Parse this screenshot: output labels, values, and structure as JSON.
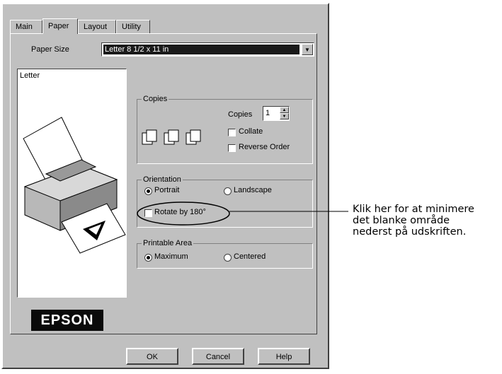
{
  "tabs": [
    "Main",
    "Paper",
    "Layout",
    "Utility"
  ],
  "paper_size": {
    "label": "Paper Size",
    "value": "Letter 8 1/2 x 11 in"
  },
  "preview": {
    "label": "Letter",
    "logo": "EPSON"
  },
  "copies_group": {
    "title": "Copies",
    "copies_label": "Copies",
    "copies_value": "1",
    "collate_label": "Collate",
    "reverse_label": "Reverse Order"
  },
  "orientation_group": {
    "title": "Orientation",
    "portrait_label": "Portrait",
    "landscape_label": "Landscape",
    "rotate_label": "Rotate by 180°",
    "selected": "Portrait"
  },
  "printable_group": {
    "title": "Printable Area",
    "maximum_label": "Maximum",
    "centered_label": "Centered",
    "selected": "Maximum"
  },
  "buttons": {
    "ok": "OK",
    "cancel": "Cancel",
    "help": "Help"
  },
  "annotation": {
    "line1": "Klik her for at minimere",
    "line2": "det blanke område",
    "line3": "nederst på udskriften."
  }
}
